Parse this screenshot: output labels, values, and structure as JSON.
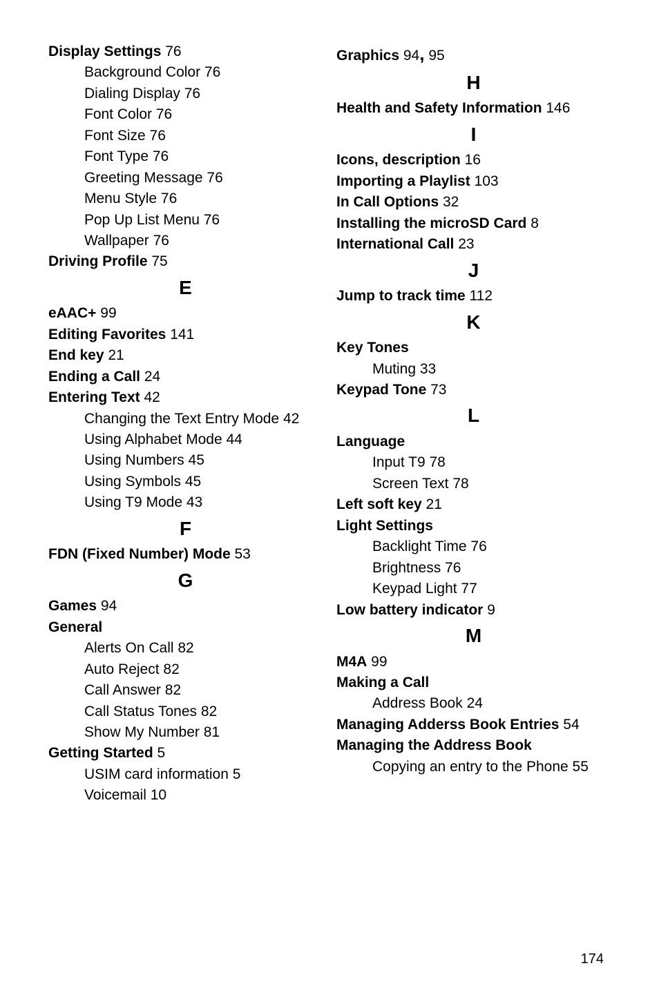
{
  "left": [
    {
      "type": "topic",
      "term": "Display Settings",
      "page": "76"
    },
    {
      "type": "sub",
      "text": "Background Color 76"
    },
    {
      "type": "sub",
      "text": "Dialing Display 76"
    },
    {
      "type": "sub",
      "text": "Font Color 76"
    },
    {
      "type": "sub",
      "text": "Font Size 76"
    },
    {
      "type": "sub",
      "text": "Font Type 76"
    },
    {
      "type": "sub",
      "text": "Greeting Message 76"
    },
    {
      "type": "sub",
      "text": "Menu Style 76"
    },
    {
      "type": "sub",
      "text": "Pop Up List Menu 76"
    },
    {
      "type": "sub",
      "text": "Wallpaper 76"
    },
    {
      "type": "topic",
      "term": "Driving Profile",
      "page": "75"
    },
    {
      "type": "head",
      "text": "E"
    },
    {
      "type": "topic",
      "term": "eAAC+",
      "page": "99"
    },
    {
      "type": "topic",
      "term": "Editing Favorites",
      "page": "141"
    },
    {
      "type": "topic",
      "term": "End key",
      "page": "21"
    },
    {
      "type": "topic",
      "term": "Ending a Call",
      "page": "24"
    },
    {
      "type": "topic",
      "term": "Entering Text",
      "page": "42"
    },
    {
      "type": "subw",
      "text": "Changing the Text Entry Mode 42"
    },
    {
      "type": "sub",
      "text": "Using Alphabet Mode 44"
    },
    {
      "type": "sub",
      "text": "Using Numbers 45"
    },
    {
      "type": "sub",
      "text": "Using Symbols 45"
    },
    {
      "type": "sub",
      "text": "Using T9 Mode 43"
    },
    {
      "type": "head",
      "text": "F"
    },
    {
      "type": "topic",
      "term": "FDN (Fixed Number) Mode",
      "page": "53"
    },
    {
      "type": "head",
      "text": "G"
    },
    {
      "type": "topic",
      "term": "Games",
      "page": "94"
    },
    {
      "type": "topic",
      "term": "General",
      "page": ""
    },
    {
      "type": "sub",
      "text": "Alerts On Call 82"
    },
    {
      "type": "sub",
      "text": "Auto Reject 82"
    },
    {
      "type": "sub",
      "text": "Call Answer 82"
    },
    {
      "type": "sub",
      "text": "Call Status Tones 82"
    },
    {
      "type": "sub",
      "text": "Show My Number 81"
    },
    {
      "type": "topic",
      "term": "Getting Started",
      "page": "5"
    },
    {
      "type": "sub",
      "text": "USIM card information 5"
    },
    {
      "type": "sub",
      "text": "Voicemail 10"
    }
  ],
  "right": [
    {
      "type": "raw",
      "html": "<span class=\"term\">Graphics</span> 94<span style=\"font-size:26px;font-weight:700\">,</span> 95"
    },
    {
      "type": "head",
      "text": "H"
    },
    {
      "type": "topic",
      "term": "Health and Safety Information",
      "page": "146"
    },
    {
      "type": "head",
      "text": "I"
    },
    {
      "type": "topic",
      "term": "Icons, description",
      "page": "16"
    },
    {
      "type": "topic",
      "term": "Importing a Playlist",
      "page": "103"
    },
    {
      "type": "topic",
      "term": "In Call Options",
      "page": "32"
    },
    {
      "type": "topic",
      "term": "Installing the microSD Card",
      "page": "8"
    },
    {
      "type": "topic",
      "term": "International Call",
      "page": "23"
    },
    {
      "type": "head",
      "text": "J"
    },
    {
      "type": "topic",
      "term": "Jump to track time",
      "page": "112"
    },
    {
      "type": "head",
      "text": "K"
    },
    {
      "type": "topic",
      "term": "Key Tones",
      "page": ""
    },
    {
      "type": "sub",
      "text": "Muting 33"
    },
    {
      "type": "topic",
      "term": "Keypad Tone",
      "page": "73"
    },
    {
      "type": "head",
      "text": "L"
    },
    {
      "type": "topic",
      "term": "Language",
      "page": ""
    },
    {
      "type": "sub",
      "text": "Input T9 78"
    },
    {
      "type": "sub",
      "text": "Screen Text 78"
    },
    {
      "type": "topic",
      "term": "Left soft key",
      "page": "21"
    },
    {
      "type": "topic",
      "term": "Light Settings",
      "page": ""
    },
    {
      "type": "sub",
      "text": "Backlight Time 76"
    },
    {
      "type": "sub",
      "text": "Brightness 76"
    },
    {
      "type": "sub",
      "text": "Keypad Light 77"
    },
    {
      "type": "topic",
      "term": "Low battery indicator",
      "page": "9"
    },
    {
      "type": "head",
      "text": "M"
    },
    {
      "type": "topic",
      "term": "M4A",
      "page": "99"
    },
    {
      "type": "topic",
      "term": "Making a Call",
      "page": ""
    },
    {
      "type": "sub",
      "text": "Address Book 24"
    },
    {
      "type": "topic",
      "term": "Managing Adderss Book Entries",
      "page": "54"
    },
    {
      "type": "topic",
      "term": "Managing the Address Book",
      "page": ""
    },
    {
      "type": "subw",
      "text": "Copying an entry to the Phone 55"
    }
  ],
  "pageNumber": "174"
}
